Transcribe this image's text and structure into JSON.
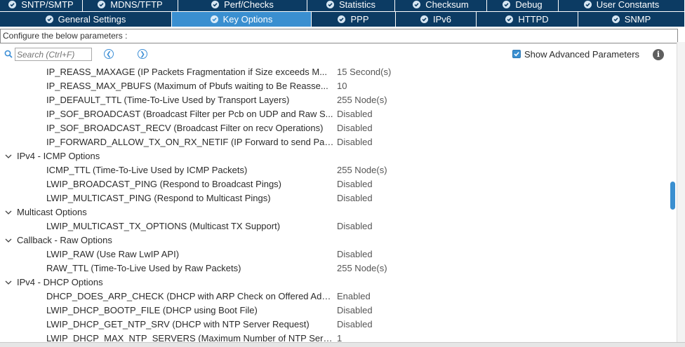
{
  "tabs_row1": [
    {
      "label": "SNTP/SMTP"
    },
    {
      "label": "MDNS/TFTP"
    },
    {
      "label": "Perf/Checks"
    },
    {
      "label": "Statistics"
    },
    {
      "label": "Checksum"
    },
    {
      "label": "Debug"
    },
    {
      "label": "User Constants"
    }
  ],
  "tabs_row2": [
    {
      "label": "General Settings",
      "active": false
    },
    {
      "label": "Key Options",
      "active": true
    },
    {
      "label": "PPP",
      "active": false
    },
    {
      "label": "IPv6",
      "active": false
    },
    {
      "label": "HTTPD",
      "active": false
    },
    {
      "label": "SNMP",
      "active": false
    }
  ],
  "description": "Configure the below parameters :",
  "search": {
    "placeholder": "Search (Ctrl+F)"
  },
  "advanced": {
    "label": "Show Advanced Parameters",
    "checked": true
  },
  "params_pre": [
    {
      "name": "IP_REASS_MAXAGE (IP Packets Fragmentation if Size exceeds M...",
      "value": "15 Second(s)"
    },
    {
      "name": "IP_REASS_MAX_PBUFS (Maximum of Pbufs waiting to Be Reasse...",
      "value": "10"
    },
    {
      "name": "IP_DEFAULT_TTL (Time-To-Live Used by Transport Layers)",
      "value": "255 Node(s)"
    },
    {
      "name": "IP_SOF_BROADCAST (Broadcast Filter per Pcb on UDP and Raw S...",
      "value": "Disabled"
    },
    {
      "name": "IP_SOF_BROADCAST_RECV (Broadcast Filter on recv Operations)",
      "value": "Disabled"
    },
    {
      "name": "IP_FORWARD_ALLOW_TX_ON_RX_NETIF (IP Forward to send Pac...",
      "value": "Disabled"
    }
  ],
  "groups": [
    {
      "title": "IPv4 - ICMP Options",
      "params": [
        {
          "name": "ICMP_TTL (Time-To-Live Used by ICMP Packets)",
          "value": "255 Node(s)"
        },
        {
          "name": "LWIP_BROADCAST_PING (Respond to Broadcast Pings)",
          "value": "Disabled"
        },
        {
          "name": "LWIP_MULTICAST_PING (Respond to Multicast Pings)",
          "value": "Disabled"
        }
      ]
    },
    {
      "title": "Multicast Options",
      "params": [
        {
          "name": "LWIP_MULTICAST_TX_OPTIONS (Multicast TX Support)",
          "value": "Disabled"
        }
      ]
    },
    {
      "title": "Callback - Raw Options",
      "params": [
        {
          "name": "LWIP_RAW (Use Raw LwIP API)",
          "value": "Disabled"
        },
        {
          "name": "RAW_TTL (Time-To-Live Used by Raw Packets)",
          "value": "255 Node(s)"
        }
      ]
    },
    {
      "title": "IPv4 - DHCP Options",
      "params": [
        {
          "name": "DHCP_DOES_ARP_CHECK (DHCP with ARP Check on Offered Add...",
          "value": "Enabled"
        },
        {
          "name": "LWIP_DHCP_BOOTP_FILE (DHCP using Boot File)",
          "value": "Disabled"
        },
        {
          "name": "LWIP_DHCP_GET_NTP_SRV (DHCP with NTP Server Request)",
          "value": "Disabled"
        },
        {
          "name": "LWIP_DHCP_MAX_NTP_SERVERS (Maximum Number of NTP Serv...",
          "value": "1"
        }
      ]
    }
  ],
  "colors": {
    "tab_bg": "#0c3b63",
    "tab_active": "#3a8fd0",
    "accent": "#3a8fd0"
  },
  "icons": {
    "tab": "check-circle-icon",
    "search": "search-icon",
    "prev": "chevron-left-circle-icon",
    "next": "chevron-right-circle-icon",
    "info": "info-icon",
    "group": "chevron-down-icon"
  }
}
